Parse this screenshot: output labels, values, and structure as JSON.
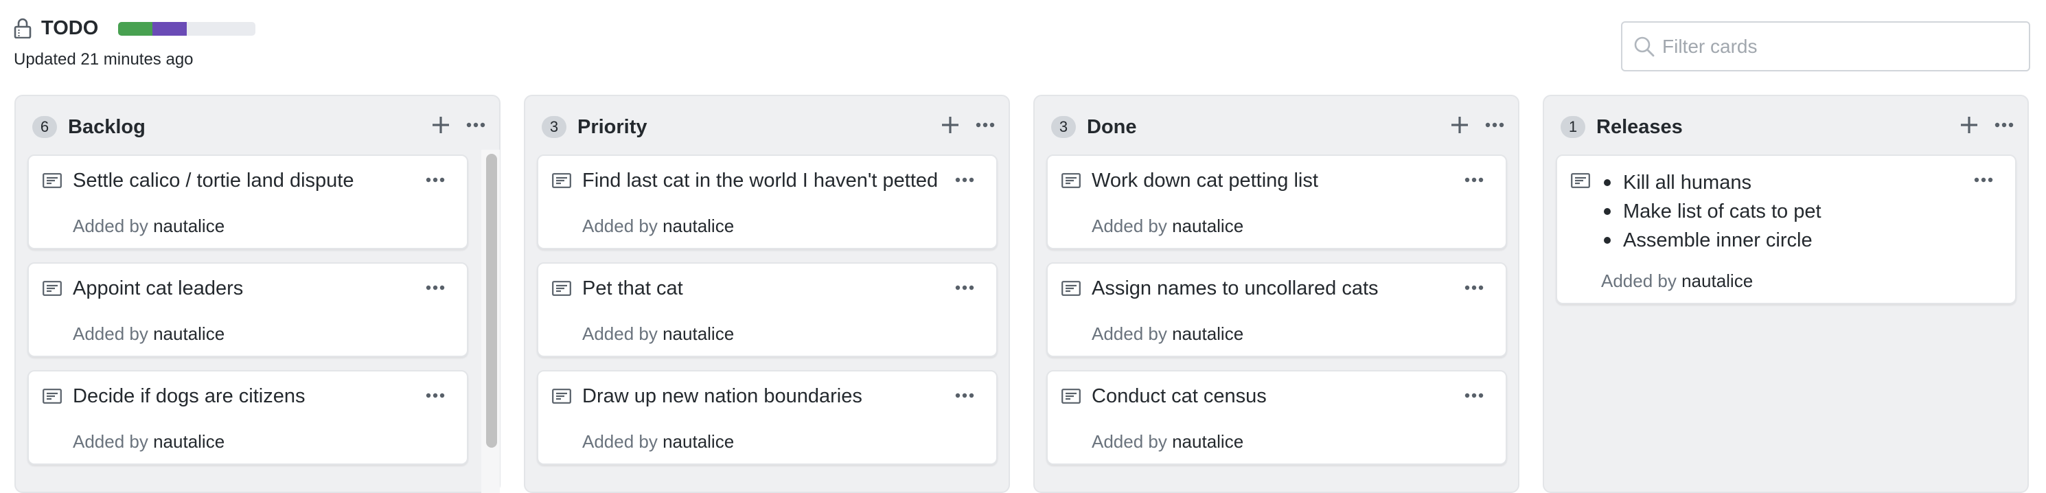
{
  "project": {
    "title": "TODO",
    "updated": "Updated 21 minutes ago",
    "visibility_icon": "lock-icon",
    "progress": {
      "segments": [
        {
          "name": "done",
          "fraction": 0.25,
          "color": "#48a151"
        },
        {
          "name": "in-progress",
          "fraction": 0.25,
          "color": "#6a4bb6"
        }
      ],
      "track_color": "#e9ebef"
    }
  },
  "filter": {
    "placeholder": "Filter cards",
    "value": "",
    "icon": "search-icon"
  },
  "card_meta_prefix": "Added by ",
  "columns": [
    {
      "name": "Backlog",
      "count": "6",
      "cards": [
        {
          "title": "Settle calico / tortie land dispute",
          "author": "nautalice"
        },
        {
          "title": "Appoint cat leaders",
          "author": "nautalice"
        },
        {
          "title": "Decide if dogs are citizens",
          "author": "nautalice"
        }
      ],
      "has_scrollbar": true
    },
    {
      "name": "Priority",
      "count": "3",
      "cards": [
        {
          "title": "Find last cat in the world I haven't petted",
          "author": "nautalice"
        },
        {
          "title": "Pet that cat",
          "author": "nautalice"
        },
        {
          "title": "Draw up new nation boundaries",
          "author": "nautalice"
        }
      ]
    },
    {
      "name": "Done",
      "count": "3",
      "cards": [
        {
          "title": "Work down cat petting list",
          "author": "nautalice"
        },
        {
          "title": "Assign names to uncollared cats",
          "author": "nautalice"
        },
        {
          "title": "Conduct cat census",
          "author": "nautalice"
        }
      ]
    },
    {
      "name": "Releases",
      "count": "1",
      "cards": [
        {
          "list": [
            "Kill all humans",
            "Make list of cats to pet",
            "Assemble inner circle"
          ],
          "author": "nautalice"
        }
      ]
    }
  ]
}
